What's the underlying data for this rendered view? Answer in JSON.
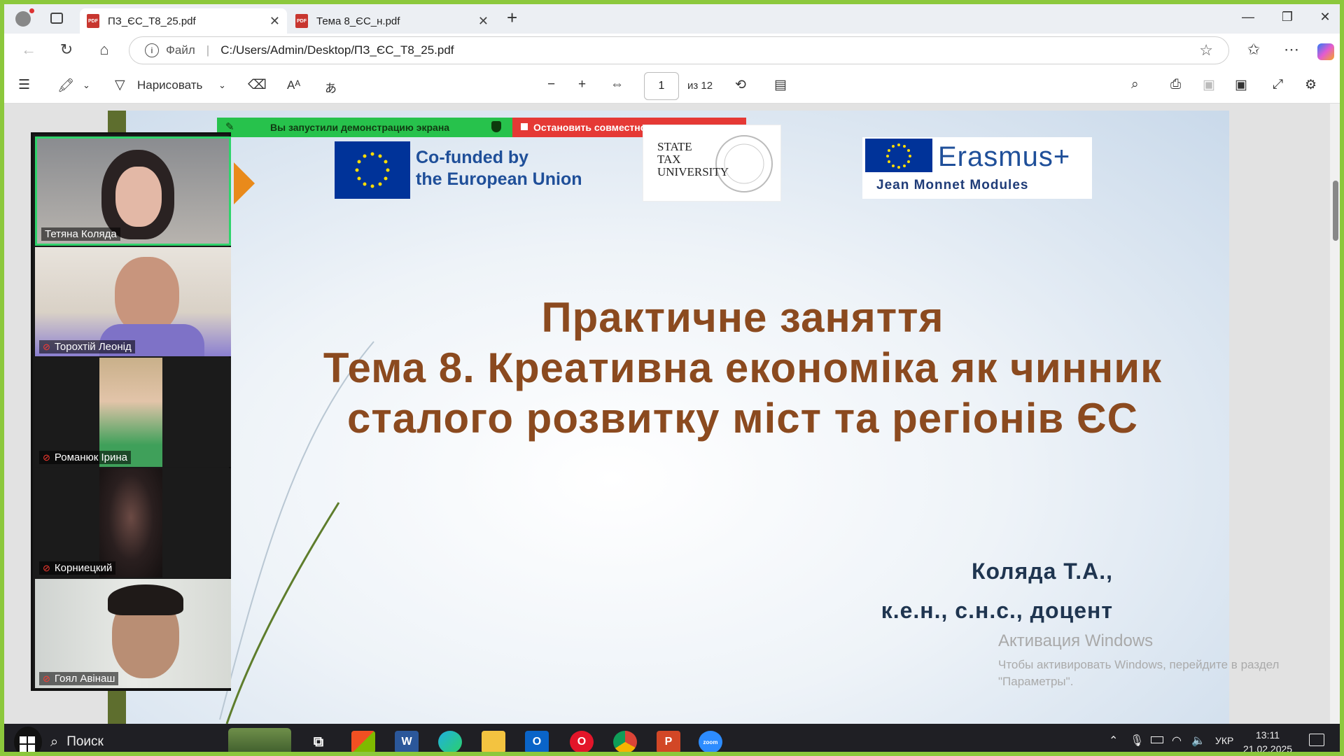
{
  "browser": {
    "tabs": [
      {
        "title": "ПЗ_ЄС_Т8_25.pdf",
        "active": true
      },
      {
        "title": "Тема 8_ЄС_н.pdf",
        "active": false
      }
    ],
    "address_prefix": "Файл",
    "address": "C:/Users/Admin/Desktop/ПЗ_ЄС_Т8_25.pdf"
  },
  "pdf_toolbar": {
    "draw_label": "Нарисовать",
    "page_current": "1",
    "page_total": "из 12"
  },
  "share_banner": {
    "sharing_text": "Вы запустили демонстрацию экрана",
    "stop_text": "Остановить совместное использование"
  },
  "slide": {
    "eu_logo_text": [
      "Co-funded by",
      "the European Union"
    ],
    "university_logo_text": [
      "STATE",
      "TAX",
      "UNIVERSITY"
    ],
    "erasmus_word": "Erasmus+",
    "erasmus_sub": "Jean Monnet Modules",
    "title_lines": [
      "Практичне заняття",
      "Тема 8. Креативна економіка як чинник",
      "сталого розвитку міст та регіонів ЄС"
    ],
    "author_name": "Коляда Т.А.,",
    "author_degree": "к.е.н., с.н.с., доцент"
  },
  "windows_activation": {
    "title": "Активация Windows",
    "text": "Чтобы активировать Windows, перейдите в раздел \"Параметры\"."
  },
  "participants": [
    {
      "name": "Тетяна Коляда",
      "muted": false,
      "speaking": true
    },
    {
      "name": "Торохтій Леонід",
      "muted": true
    },
    {
      "name": "Романюк Ірина",
      "muted": true
    },
    {
      "name": "Корниецкий",
      "muted": true
    },
    {
      "name": "Гоял Авінаш",
      "muted": true
    }
  ],
  "taskbar": {
    "search_label": "Поиск",
    "language": "УКР",
    "time": "13:11",
    "date": "21.02.2025"
  }
}
